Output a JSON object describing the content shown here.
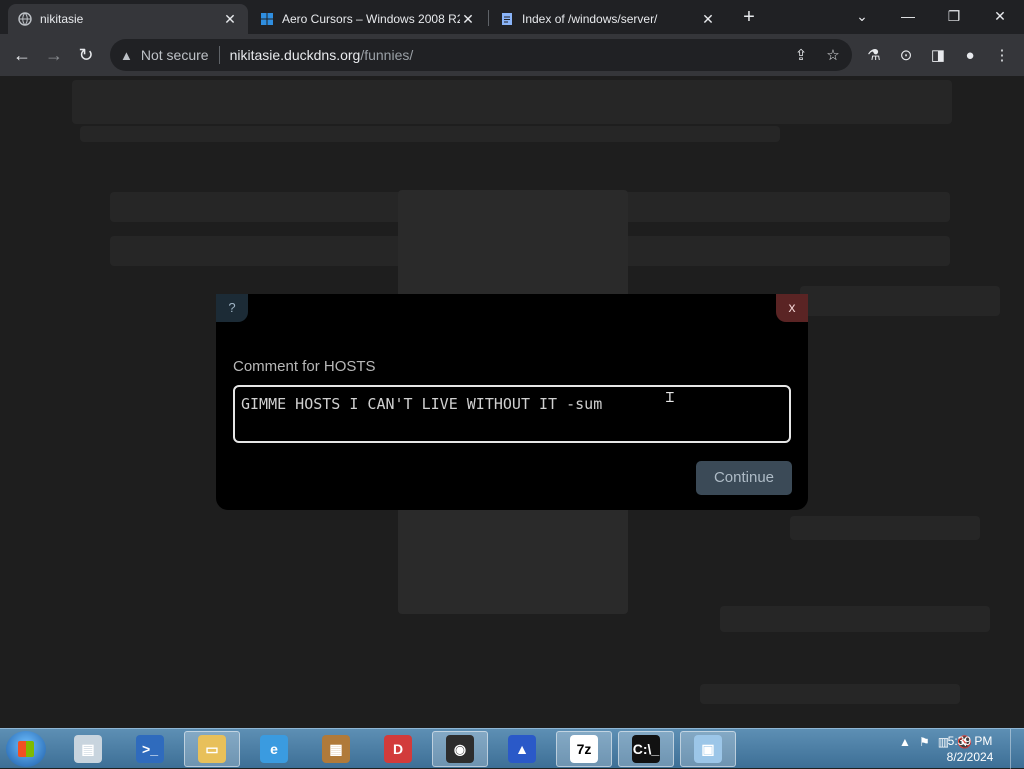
{
  "browser": {
    "tabs": [
      {
        "title": "nikitasie",
        "active": true,
        "favicon": "globe-icon"
      },
      {
        "title": "Aero Cursors – Windows 2008 R2",
        "active": false,
        "favicon": "windows-icon"
      },
      {
        "title": "Index of /windows/server/",
        "active": false,
        "favicon": "document-icon"
      }
    ],
    "tab_close": "✕",
    "new_tab": "+",
    "window": {
      "minimize": "—",
      "restore": "❐",
      "close": "✕",
      "tab_search": "⌄"
    },
    "address": {
      "security_label": "Not secure",
      "host": "nikitasie.duckdns.org",
      "path": "/funnies/"
    }
  },
  "modal": {
    "help": "?",
    "close": "x",
    "label": "Comment for HOSTS",
    "input_value": "GIMME HOSTS I CAN'T LIVE WITHOUT IT -sum",
    "continue": "Continue"
  },
  "taskbar": {
    "apps": [
      {
        "name": "server-manager",
        "glyph": "▤",
        "color": "#c8d4de",
        "open": false
      },
      {
        "name": "powershell",
        "glyph": ">_",
        "color": "#2f6bbd",
        "open": false
      },
      {
        "name": "file-explorer",
        "glyph": "▭",
        "color": "#e8c05a",
        "open": true
      },
      {
        "name": "internet-explorer",
        "glyph": "e",
        "color": "#3a9be0",
        "open": false
      },
      {
        "name": "archive-tool",
        "glyph": "▦",
        "color": "#b07a3a",
        "open": false
      },
      {
        "name": "daemon-tools",
        "glyph": "D",
        "color": "#d23b3b",
        "open": false
      },
      {
        "name": "chrome-browser",
        "glyph": "◉",
        "color": "#2d2d2d",
        "open": true
      },
      {
        "name": "blue-app",
        "glyph": "▲",
        "color": "#2a59c8",
        "open": false
      },
      {
        "name": "7zip",
        "glyph": "7z",
        "color": "#ffffff",
        "open": true
      },
      {
        "name": "command-prompt",
        "glyph": "C:\\_",
        "color": "#111111",
        "open": true
      },
      {
        "name": "control-panel",
        "glyph": "▣",
        "color": "#9cc6e8",
        "open": true
      }
    ],
    "time": "5:39 PM",
    "date": "8/2/2024"
  }
}
